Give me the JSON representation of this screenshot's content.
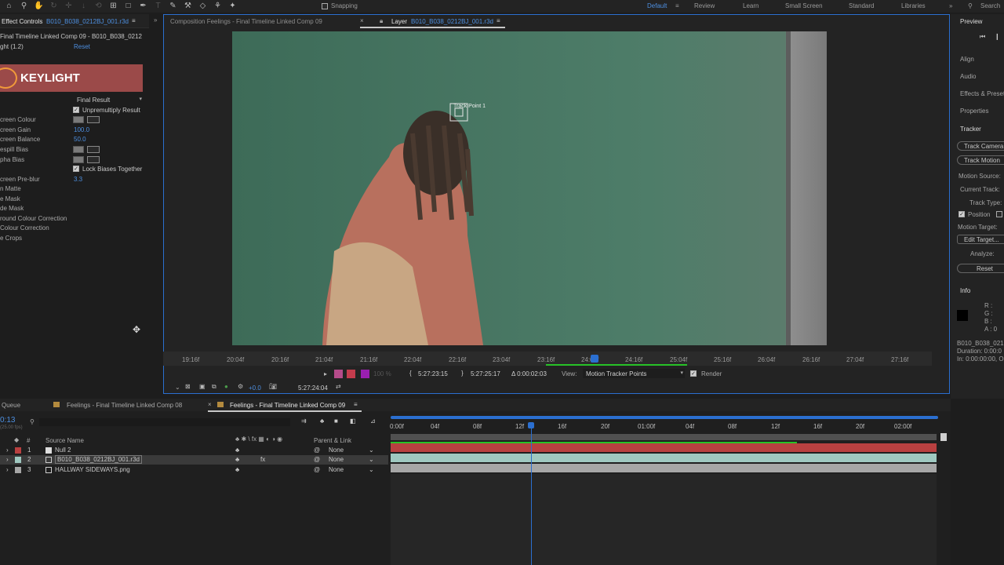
{
  "toolbar": {
    "snapping": "Snapping",
    "workspaces": [
      "Default",
      "Review",
      "Learn",
      "Small Screen",
      "Standard",
      "Libraries"
    ],
    "search": "Search"
  },
  "effect_controls": {
    "tab_label": "Effect Controls",
    "tab_layer": "B010_B038_0212BJ_001.r3d",
    "breadcrumb": "Final Timeline Linked Comp 09 - B010_B038_0212",
    "effect_name": "ght (1.2)",
    "reset": "Reset",
    "logo_text": "KEYLIGHT",
    "view_value": "Final Result",
    "unpremultiply": "Unpremultiply Result",
    "screen_colour": "creen Colour",
    "screen_gain": "creen Gain",
    "screen_gain_val": "100.0",
    "screen_balance": "creen Balance",
    "screen_balance_val": "50.0",
    "despill_bias": "espill Bias",
    "alpha_bias": "pha Bias",
    "lock_biases": "Lock Biases Together",
    "screen_preblur": "creen Pre-blur",
    "screen_preblur_val": "3.3",
    "items": [
      "n Matte",
      "e Mask",
      "de Mask",
      "round Colour Correction",
      "Colour Correction",
      "e Crops"
    ]
  },
  "viewer": {
    "comp_tab": "Composition Feelings - Final Timeline Linked Comp 09",
    "layer_tab_prefix": "Layer",
    "layer_tab_name": "B010_B038_0212BJ_001.r3d",
    "track_point": "Track Point 1",
    "ruler_ticks": [
      "19:16f",
      "20:04f",
      "20:16f",
      "21:04f",
      "21:16f",
      "22:04f",
      "22:16f",
      "23:04f",
      "23:16f",
      "24:04f",
      "24:16f",
      "25:04f",
      "25:16f",
      "26:04f",
      "26:16f",
      "27:04f",
      "27:16f"
    ],
    "in_time": "5:27:23:15",
    "out_time": "5:27:25:17",
    "duration": "Δ 0:00:02:03",
    "view_label": "View:",
    "view_value": "Motion Tracker Points",
    "render_label": "Render",
    "offset": "+0.0",
    "current_time": "5:27:24:04",
    "zoom": "100 %"
  },
  "right_panel": {
    "preview": "Preview",
    "align": "Align",
    "audio": "Audio",
    "effects": "Effects & Presets",
    "properties": "Properties",
    "tracker": "Tracker",
    "track_camera": "Track Camera",
    "track_motion": "Track Motion",
    "motion_source": "Motion Source:",
    "current_track": "Current Track:",
    "track_type": "Track Type:",
    "position": "Position",
    "motion_target": "Motion Target:",
    "edit_target": "Edit Target...",
    "analyze": "Analyze:",
    "reset": "Reset",
    "info": "Info",
    "info_r": "R :",
    "info_g": "G :",
    "info_b": "B :",
    "info_a": "A : 0",
    "info_name": "B010_B038_0212",
    "info_duration": "Duration: 0:00:0",
    "info_inout": "In: 0:00:00:00, O"
  },
  "timeline": {
    "queue_tab": "Queue",
    "tab1": "Feelings - Final Timeline Linked Comp 08",
    "tab2": "Feelings - Final Timeline Linked Comp 09",
    "timecode": "0:13",
    "fps": "(25.00 fps)",
    "col_hash": "#",
    "col_source": "Source Name",
    "col_parent": "Parent & Link",
    "layers": [
      {
        "num": "1",
        "name": "Null 2",
        "parent": "None"
      },
      {
        "num": "2",
        "name": "B010_B038_0212BJ_001.r3d",
        "parent": "None"
      },
      {
        "num": "3",
        "name": "HALLWAY SIDEWAYS.png",
        "parent": "None"
      }
    ],
    "ticks": [
      "0:00f",
      "04f",
      "08f",
      "12f",
      "16f",
      "20f",
      "01:00f",
      "04f",
      "08f",
      "12f",
      "16f",
      "20f",
      "02:00f"
    ],
    "colors": {
      "null": "#d1d1d1",
      "layer2": "#9fc8c0",
      "layer3": "#a6a6a6",
      "red": "#b84040"
    }
  }
}
